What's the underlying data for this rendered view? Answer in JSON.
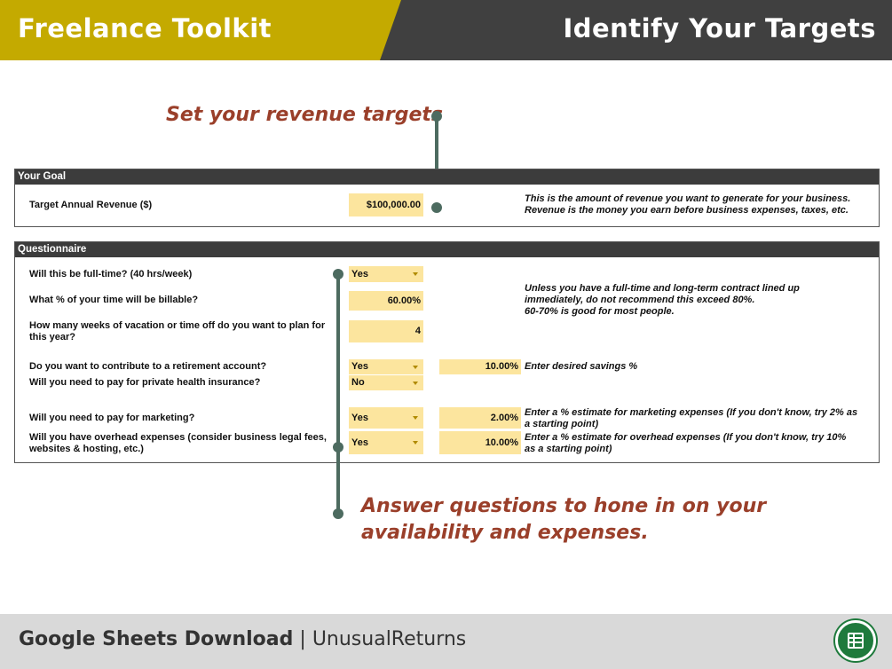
{
  "header": {
    "left_title": "Freelance Toolkit",
    "right_title": "Identify Your Targets"
  },
  "callouts": {
    "revenue": "Set your revenue targets",
    "questions_line1": "Answer questions to hone in on your",
    "questions_line2": "availability and expenses."
  },
  "goal": {
    "heading": "Your Goal",
    "label": "Target Annual Revenue ($)",
    "value": "$100,000.00",
    "note_line1": "This is the amount of revenue you want to generate for your business.",
    "note_line2": "Revenue is the money you earn before business expenses, taxes, etc."
  },
  "questionnaire": {
    "heading": "Questionnaire",
    "full_time": {
      "label": "Will this be full-time? (40 hrs/week)",
      "value": "Yes"
    },
    "billable": {
      "label": "What % of your time will be billable?",
      "value": "60.00%",
      "note_line1": "Unless you have a full-time and long-term contract lined up",
      "note_line2": "immediately, do not recommend this exceed 80%.",
      "note_line3": "60-70% is good for most people."
    },
    "vacation": {
      "label_line1": "How many weeks of vacation or time off do you want to plan for",
      "label_line2": "this year?",
      "value": "4"
    },
    "retirement": {
      "label": "Do you want to contribute to a retirement account?",
      "value": "Yes",
      "percent": "10.00%",
      "note": "Enter desired savings %"
    },
    "health": {
      "label": "Will you need to pay for private health insurance?",
      "value": "No"
    },
    "marketing": {
      "label": "Will you need to pay for marketing?",
      "value": "Yes",
      "percent": "2.00%",
      "note_line1": "Enter a % estimate for marketing expenses (If you don't know, try 2% as",
      "note_line2": "a starting point)"
    },
    "overhead": {
      "label_line1": "Will you have overhead expenses (consider business legal fees,",
      "label_line2": "websites & hosting, etc.)",
      "value": "Yes",
      "percent": "10.00%",
      "note_line1": "Enter a % estimate for overhead expenses (If you don't know, try 10%",
      "note_line2": "as a starting point)"
    }
  },
  "footer": {
    "bold": "Google Sheets Download",
    "separator": "|",
    "brand": "UnusualReturns",
    "icon": "google-sheets-icon"
  },
  "colors": {
    "header_gold": "#c4aa00",
    "header_dark": "#404040",
    "callout_text": "#9a3f2a",
    "connector": "#4d6b60",
    "input_cell": "#fce59e",
    "footer_bg": "#d9d9d9",
    "sheets_green": "#1e7a3c"
  }
}
